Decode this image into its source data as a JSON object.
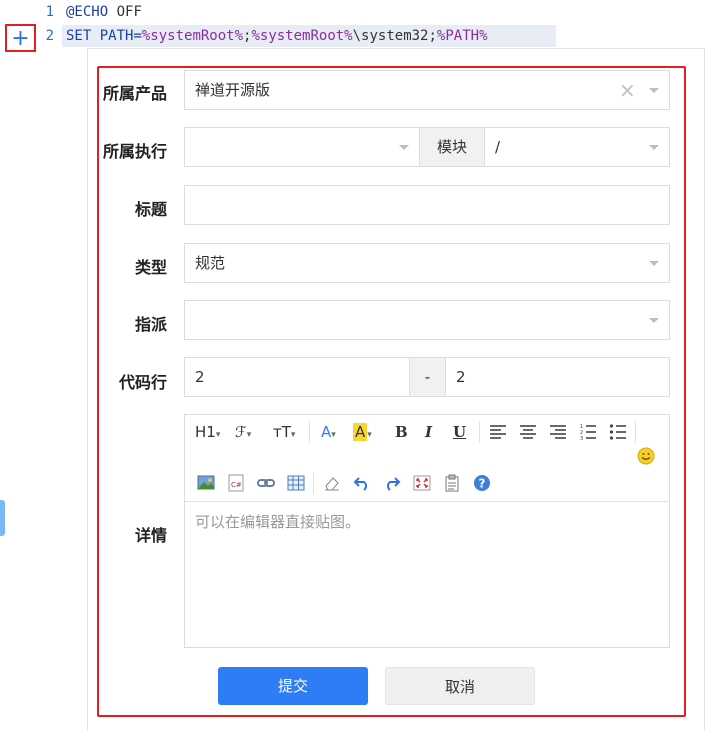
{
  "code": {
    "line1": {
      "no": "1",
      "kw": "@ECHO",
      "rest": " OFF"
    },
    "line2": {
      "no": "2",
      "kw": "SET",
      "rest1": " PATH=",
      "var1": "%systemRoot%",
      "sep1": ";",
      "var2": "%systemRoot%",
      "rest2": "\\system32;",
      "var3": "%PATH%"
    }
  },
  "add_button": {
    "glyph": "+"
  },
  "form": {
    "product": {
      "label": "所属产品",
      "value": "禅道开源版",
      "clear": "×"
    },
    "execution": {
      "label": "所属执行",
      "value": "",
      "module_label": "模块",
      "module_value": "/"
    },
    "title": {
      "label": "标题",
      "value": ""
    },
    "type": {
      "label": "类型",
      "value": "规范"
    },
    "assign": {
      "label": "指派",
      "value": ""
    },
    "lines": {
      "label": "代码行",
      "start": "2",
      "sep": "-",
      "end": "2"
    },
    "detail": {
      "label": "详情",
      "placeholder": "可以在编辑器直接贴图。",
      "toolbar": {
        "h1": "H1",
        "font": "ℱ",
        "size": "тT",
        "color": "A",
        "bg": "A",
        "bold": "B",
        "italic": "I",
        "underline": "U"
      }
    }
  },
  "buttons": {
    "submit": "提交",
    "cancel": "取消"
  },
  "colors": {
    "primary": "#2e7cf6",
    "highlight": "#e02020",
    "keyword": "#1a3fa8",
    "variable": "#8a2e9d"
  }
}
